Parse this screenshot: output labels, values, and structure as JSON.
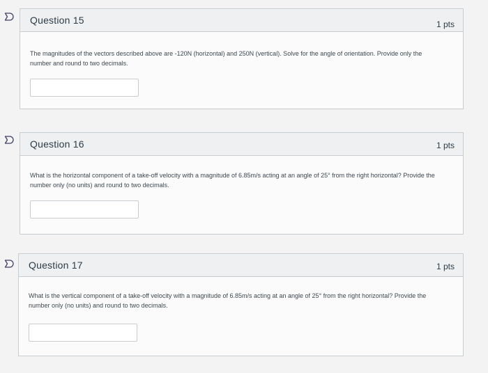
{
  "questions": [
    {
      "title": "Question 15",
      "points": "1 pts",
      "text": "The magnitudes of the vectors described above are -120N (horizontal) and 250N (vertical). Solve for the angle of orientation. Provide only the number and round to two decimals.",
      "answer_value": ""
    },
    {
      "title": "Question 16",
      "points": "1 pts",
      "text": "What is the horizontal component of a take-off velocity with a magnitude of 6.85m/s acting at an angle of 25° from the right horizontal? Provide the number only (no units) and round to two decimals.",
      "answer_value": ""
    },
    {
      "title": "Question 17",
      "points": "1 pts",
      "text": "What is the vertical component of a take-off velocity with a magnitude of 6.85m/s acting at an angle of 25° from the right horizontal? Provide the number only (no units) and round to two decimals.",
      "answer_value": ""
    }
  ],
  "colors": {
    "flag_stroke": "#3f3f66",
    "header_bg": "#eef0f1",
    "border": "#c7cdd1"
  },
  "icons": {
    "flag": "bookmark-flag-icon"
  }
}
